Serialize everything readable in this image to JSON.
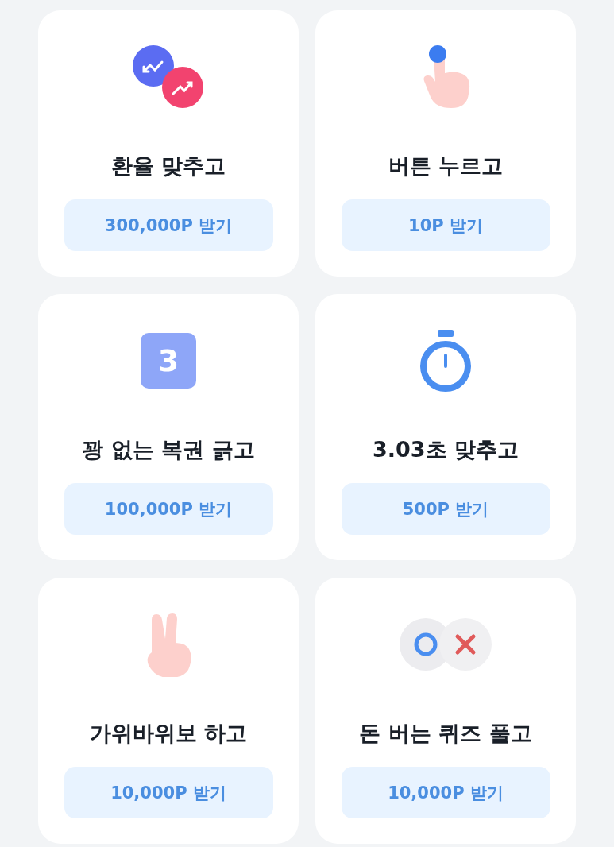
{
  "cards": [
    {
      "title": "환율 맞추고",
      "reward": "300,000P 받기"
    },
    {
      "title": "버튼 누르고",
      "reward": "10P 받기"
    },
    {
      "badge": "3",
      "title": "꽝 없는 복권 긁고",
      "reward": "100,000P 받기"
    },
    {
      "title": "3.03초 맞추고",
      "reward": "500P 받기"
    },
    {
      "title": "가위바위보 하고",
      "reward": "10,000P 받기"
    },
    {
      "title": "돈 버는 퀴즈 풀고",
      "reward": "10,000P 받기"
    }
  ]
}
